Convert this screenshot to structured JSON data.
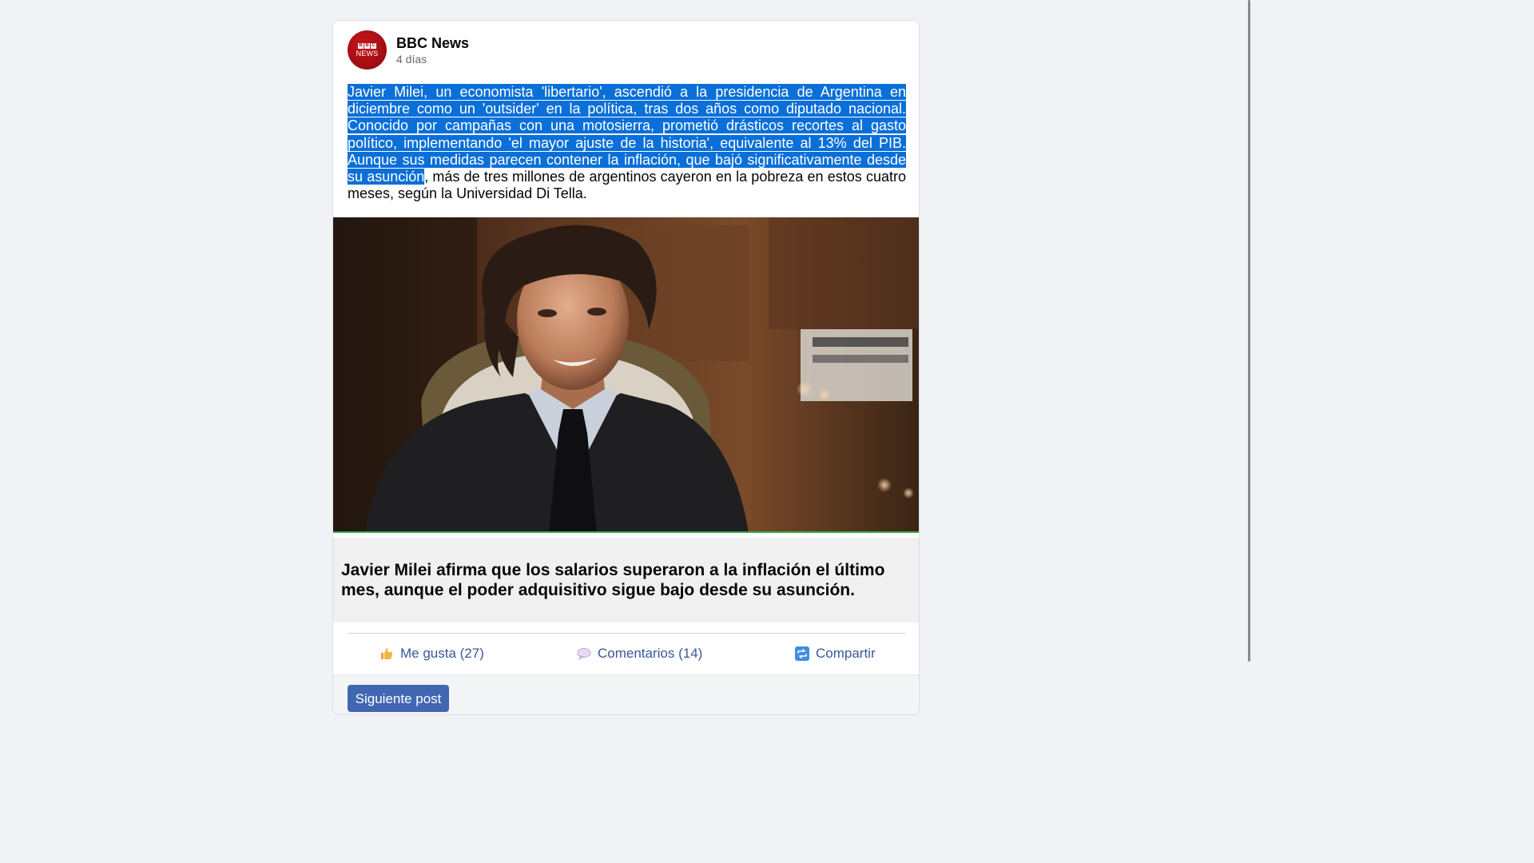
{
  "post": {
    "author": "BBC News",
    "time": "4 días",
    "avatar_logo": {
      "letters": [
        "B",
        "B",
        "C"
      ],
      "word": "NEWS"
    },
    "text_selected": "Javier Milei, un economista 'libertario', ascendió a la presidencia de Argentina en diciembre como un 'outsider' en la política, tras dos años como diputado nacional. Conocido por campañas con una motosierra, prometió drásticos recortes al gasto político, implementando 'el mayor ajuste de la historia', equivalente al 13% del PIB. Aunque sus medidas parecen contener la inflación, que bajó significativamente desde su asunción",
    "text_rest": ", más de tres millones de argentinos cayeron en la pobreza en estos cuatro meses, según la Universidad Di Tella.",
    "link_title": "Javier Milei afirma que los salarios superaron a la inflación el último mes, aunque el poder adquisitivo sigue bajo desde su asunción."
  },
  "actions": {
    "like_label": "Me gusta (27)",
    "comment_label": "Comentarios (14)",
    "share_label": "Compartir",
    "like_icon": "thumbs-up-icon",
    "comment_icon": "speech-bubble-icon",
    "share_icon": "repost-icon"
  },
  "next_button": "Siguiente post",
  "colors": {
    "selection": "#0a6fd8",
    "action_text": "#385898",
    "button": "#4267b2",
    "brand_red": "#9e0d12"
  }
}
